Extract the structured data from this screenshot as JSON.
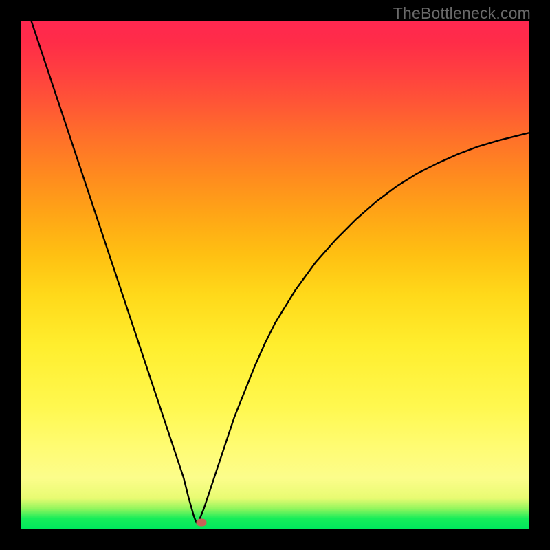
{
  "attribution": "TheBottleneck.com",
  "colors": {
    "frame": "#000000",
    "curve": "#000000",
    "marker": "#c76357"
  },
  "chart_data": {
    "type": "line",
    "title": "",
    "xlabel": "",
    "ylabel": "",
    "xlim": [
      0,
      100
    ],
    "ylim": [
      0,
      100
    ],
    "grid": false,
    "legend": false,
    "x": [
      2,
      4,
      6,
      8,
      10,
      12,
      14,
      16,
      18,
      20,
      22,
      24,
      26,
      28,
      30,
      32,
      33,
      34,
      34.5,
      35,
      36,
      38,
      40,
      42,
      44,
      46,
      48,
      50,
      54,
      58,
      62,
      66,
      70,
      74,
      78,
      82,
      86,
      90,
      94,
      98,
      100
    ],
    "values": [
      100,
      94,
      88,
      82,
      76,
      70,
      64,
      58,
      52,
      46,
      40,
      34,
      28,
      22,
      16,
      10,
      6,
      2.5,
      1.2,
      1.5,
      4,
      10,
      16,
      22,
      27,
      32,
      36.5,
      40.5,
      47,
      52.5,
      57,
      61,
      64.5,
      67.5,
      70,
      72,
      73.8,
      75.3,
      76.5,
      77.5,
      78
    ],
    "marker": {
      "x": 35.5,
      "y": 1.2
    },
    "background_gradient": {
      "direction": "bottom-to-top",
      "stops": [
        {
          "pos": 0,
          "color": "#00e85c"
        },
        {
          "pos": 10,
          "color": "#fcfd8b"
        },
        {
          "pos": 24,
          "color": "#fff84f"
        },
        {
          "pos": 46,
          "color": "#ffd91a"
        },
        {
          "pos": 70,
          "color": "#ff891f"
        },
        {
          "pos": 90,
          "color": "#ff3f40"
        },
        {
          "pos": 100,
          "color": "#ff2850"
        }
      ]
    }
  }
}
